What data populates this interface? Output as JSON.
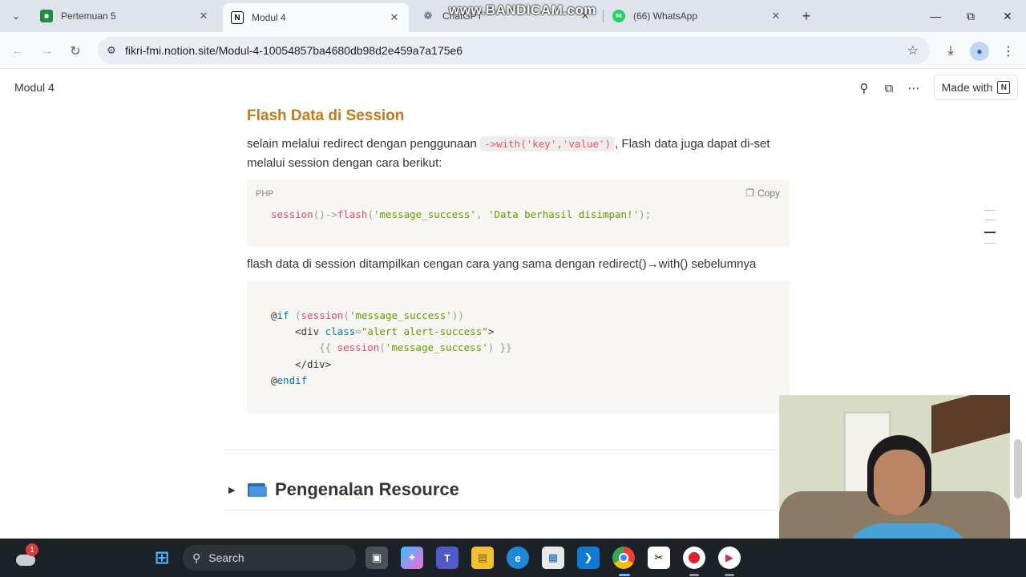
{
  "browser": {
    "tabs": [
      {
        "title": "Pertemuan 5",
        "icon": "classroom-icon",
        "active": false
      },
      {
        "title": "Modul 4",
        "icon": "notion-icon",
        "active": true
      },
      {
        "title": "ChatGPT",
        "icon": "chatgpt-icon",
        "active": false
      },
      {
        "title": "(66) WhatsApp",
        "icon": "whatsapp-icon",
        "active": false
      }
    ],
    "watermark": "www.BANDICAM.com",
    "url": "fikri-fmi.notion.site/Modul-4-10054857ba4680db98d2e459a7a175e6"
  },
  "notion": {
    "breadcrumb": "Modul 4",
    "made_with": "Made with"
  },
  "content": {
    "heading": "Flash Data di Session",
    "para1_before": "selain melalui redirect dengan penggunaan ",
    "para1_code": "->with('key','value')",
    "para1_after": ", Flash data juga dapat di-set melalui session dengan cara berikut:",
    "code1": {
      "language": "PHP",
      "copy_label": "Copy",
      "fn1": "session",
      "punc1": "()->",
      "fn2": "flash",
      "punc2": "(",
      "str1": "'message_success'",
      "punc3": ", ",
      "str2": "'Data berhasil disimpan!'",
      "punc4": ");"
    },
    "para2": "flash data di session ditampilkan cengan cara yang sama dengan redirect()→with() sebelumnya",
    "code2": {
      "l1_at": "@",
      "l1_kw": "if",
      "l1_p1": " (",
      "l1_fn": "session",
      "l1_p2": "(",
      "l1_str": "'message_success'",
      "l1_p3": "))",
      "l2_open": "<div ",
      "l2_attr": "class",
      "l2_eq": "=",
      "l2_val": "\"alert alert-success\"",
      "l2_close": ">",
      "l3_p1": "{{ ",
      "l3_fn": "session",
      "l3_p2": "(",
      "l3_str": "'message_success'",
      "l3_p3": ") }}",
      "l4": "</div>",
      "l5_at": "@",
      "l5_kw": "endif"
    },
    "toggle_title": "Pengenalan Resource"
  },
  "taskbar": {
    "weather_badge": "1",
    "search_placeholder": "Search",
    "apps": [
      "task-view",
      "copilot",
      "teams",
      "file-explorer",
      "edge",
      "store",
      "vscode",
      "chrome",
      "capcut",
      "bandicam",
      "media-player"
    ]
  },
  "colors": {
    "heading": "#c9781a",
    "inline_code": "#eb5757",
    "code_bg": "#f7f6f3",
    "taskbar": "#1c2027"
  }
}
